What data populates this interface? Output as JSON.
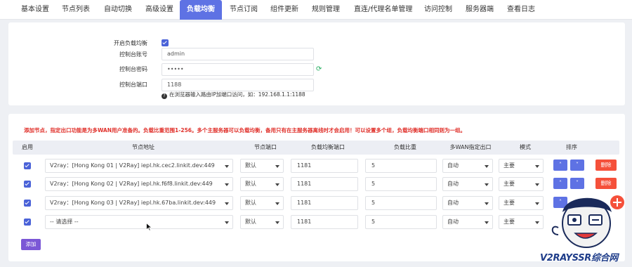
{
  "tabs": [
    {
      "label": "基本设置",
      "active": false
    },
    {
      "label": "节点列表",
      "active": false
    },
    {
      "label": "自动切换",
      "active": false
    },
    {
      "label": "高级设置",
      "active": false
    },
    {
      "label": "负载均衡",
      "active": true
    },
    {
      "label": "节点订阅",
      "active": false
    },
    {
      "label": "组件更新",
      "active": false
    },
    {
      "label": "规则管理",
      "active": false
    },
    {
      "label": "直连/代理名单管理",
      "active": false
    },
    {
      "label": "访问控制",
      "active": false
    },
    {
      "label": "服务器端",
      "active": false
    },
    {
      "label": "查看日志",
      "active": false
    }
  ],
  "console": {
    "enable_label": "开启负载均衡",
    "enable_checked": true,
    "account_label": "控制台账号",
    "account_value": "admin",
    "password_label": "控制台密码",
    "password_value": "•••••",
    "port_label": "控制台端口",
    "port_value": "1188",
    "hint_icon": "?",
    "hint": "在浏览器输入路由IP加端口访问，如：192.168.1.1:1188"
  },
  "nodes": {
    "notice": "添加节点，指定出口功能是为多WAN用户准备的。负载比重范围1-256。多个主服务器可以负载均衡，备用只有在主服务器离线时才会启用！可以设置多个组，负载均衡端口相同则为一组。",
    "headers": {
      "enable": "启用",
      "address": "节点地址",
      "node_port": "节点端口",
      "lb_port": "负载均衡端口",
      "weight": "负载比重",
      "wan": "多WAN指定出口",
      "mode": "模式",
      "order": "排序"
    },
    "rows": [
      {
        "checked": true,
        "address": "V2ray：[Hong Kong 01 | V2Ray] iepl.hk.cec2.linkit.dev:449",
        "port": "默认",
        "lb_port": "1181",
        "weight": "5",
        "wan": "自动",
        "mode": "主要",
        "up": "˄",
        "down": "˅",
        "del": "删除"
      },
      {
        "checked": true,
        "address": "V2ray：[Hong Kong 02 | V2Ray] iepl.hk.f6f8.linkit.dev:449",
        "port": "默认",
        "lb_port": "1181",
        "weight": "5",
        "wan": "自动",
        "mode": "主要",
        "up": "˄",
        "down": "˅",
        "del": "删除"
      },
      {
        "checked": true,
        "address": "V2ray：[Hong Kong 03 | V2Ray] iepl.hk.67ba.linkit.dev:449",
        "port": "默认",
        "lb_port": "1181",
        "weight": "5",
        "wan": "自动",
        "mode": "主要",
        "up": "˄",
        "down": "",
        "del": ""
      },
      {
        "checked": true,
        "address": "-- 请选择 --",
        "port": "默认",
        "lb_port": "1181",
        "weight": "5",
        "wan": "自动",
        "mode": "主要",
        "up": "",
        "down": "",
        "del": ""
      }
    ],
    "add_label": "添加"
  },
  "watermark": {
    "text": "V2RAYSSR综合网"
  },
  "colors": {
    "accent": "#5e72e4",
    "delete": "#f5503a",
    "add": "#7b57d6",
    "notice": "#e0302a"
  }
}
